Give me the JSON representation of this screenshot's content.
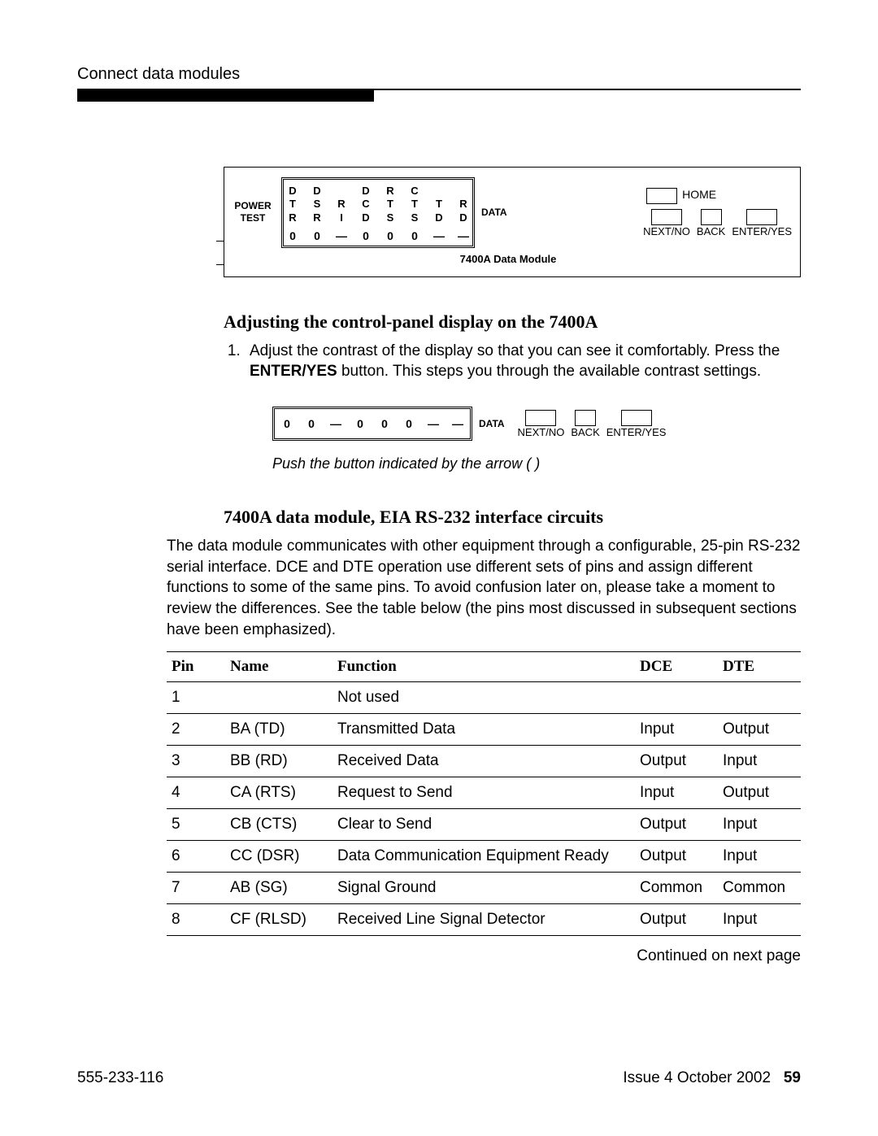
{
  "header": {
    "running": "Connect data modules"
  },
  "panel1": {
    "power_test_l1": "POWER",
    "power_test_l2": "TEST",
    "cols": [
      [
        "D",
        "T",
        "R"
      ],
      [
        "D",
        "S",
        "R"
      ],
      [
        "",
        "R",
        "I"
      ],
      [
        "D",
        "C",
        "D"
      ],
      [
        "R",
        "T",
        "S"
      ],
      [
        "C",
        "T",
        "S"
      ],
      [
        "",
        "T",
        "D"
      ],
      [
        "",
        "R",
        "D"
      ]
    ],
    "vals": [
      "0",
      "0",
      "—",
      "0",
      "0",
      "0",
      "—",
      "—"
    ],
    "data_label": "DATA",
    "home": "HOME",
    "btn_next": "NEXT/NO",
    "btn_back": "BACK",
    "btn_enter": "ENTER/YES",
    "caption": "7400A Data Module"
  },
  "sec1": {
    "title": "Adjusting the control-panel display on the 7400A",
    "step1_a": "Adjust the contrast of the display so that you can see it comfortably. Press the ",
    "step1_b": "ENTER/YES",
    "step1_c": " button. This steps you through the available contrast settings."
  },
  "panel2": {
    "vals": [
      "0",
      "0",
      "—",
      "0",
      "0",
      "0",
      "—",
      "—"
    ],
    "data_label": "DATA",
    "btn_next": "NEXT/NO",
    "btn_back": "BACK",
    "btn_enter": "ENTER/YES",
    "note": "Push the button indicated by the arrow (    )"
  },
  "sec2": {
    "title": "7400A data module, EIA RS-232 interface circuits",
    "para": "The data module communicates with other equipment through a configurable, 25-pin RS-232 serial interface. DCE and DTE operation use different sets of pins and assign different functions to some of the same pins. To avoid confusion later on, please take a moment to review the differences. See the table below (the pins most discussed in subsequent sections have been emphasized)."
  },
  "table": {
    "head": {
      "pin": "Pin",
      "name": "Name",
      "func": "Function",
      "dce": "DCE",
      "dte": "DTE"
    },
    "rows": [
      {
        "pin": "1",
        "name": "",
        "func": "Not used",
        "dce": "",
        "dte": ""
      },
      {
        "pin": "2",
        "name": "BA (TD)",
        "func": "Transmitted Data",
        "dce": "Input",
        "dte": "Output"
      },
      {
        "pin": "3",
        "name": "BB (RD)",
        "func": "Received Data",
        "dce": "Output",
        "dte": "Input"
      },
      {
        "pin": "4",
        "name": "CA (RTS)",
        "func": "Request to Send",
        "dce": "Input",
        "dte": "Output"
      },
      {
        "pin": "5",
        "name": "CB (CTS)",
        "func": "Clear to Send",
        "dce": "Output",
        "dte": "Input"
      },
      {
        "pin": "6",
        "name": "CC (DSR)",
        "func": "Data Communication Equipment Ready",
        "dce": "Output",
        "dte": "Input"
      },
      {
        "pin": "7",
        "name": "AB (SG)",
        "func": "Signal Ground",
        "dce": "Common",
        "dte": "Common"
      },
      {
        "pin": "8",
        "name": "CF (RLSD)",
        "func": "Received Line Signal Detector",
        "dce": "Output",
        "dte": "Input"
      }
    ],
    "cont": "Continued on next page"
  },
  "footer": {
    "docnum": "555-233-116",
    "issue": "Issue 4   October 2002",
    "page": "59"
  }
}
